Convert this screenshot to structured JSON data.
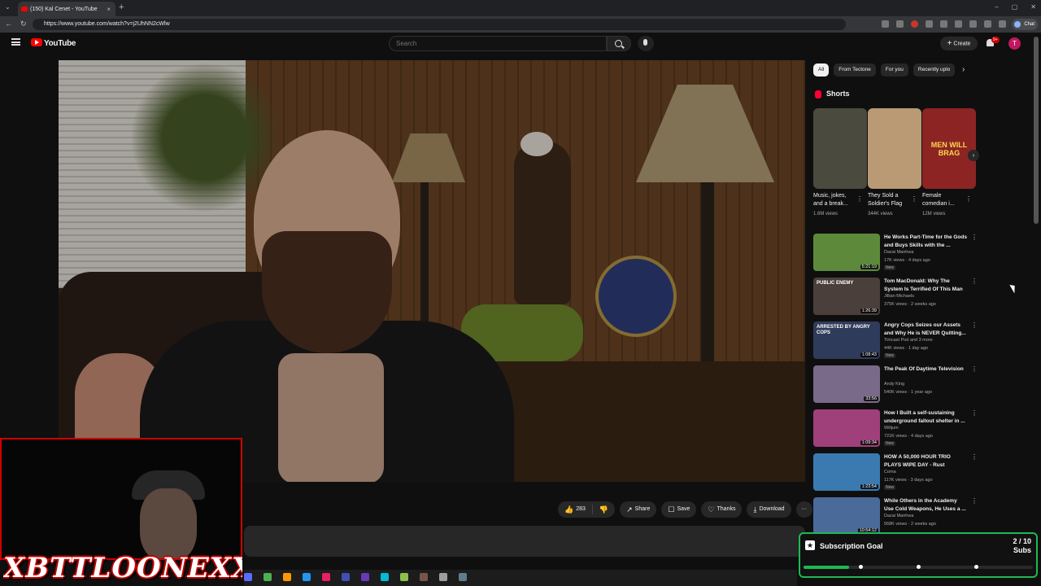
{
  "browser": {
    "tab_title": "(150) Kal Cenet - YouTube",
    "tab_close": "×",
    "new_tab": "+",
    "tabs_menu": "⌄",
    "url": "https://www.youtube.com/watch?v=j2UhNN2cWlw",
    "profile_label": "Chat",
    "back": "←",
    "forward": "→",
    "reload": "↻",
    "win_minimize": "–",
    "win_maximize": "▢",
    "win_close": "✕"
  },
  "header": {
    "logo_text": "YouTube",
    "search_placeholder": "Search",
    "create_label": "Create",
    "create_plus": "+",
    "notif_count": "9+",
    "avatar_letter": "T"
  },
  "actions": {
    "like_count": "283",
    "like_icon": "👍",
    "dislike_icon": "👎",
    "share_label": "Share",
    "share_icon": "↗",
    "save_label": "Save",
    "save_icon": "☐",
    "thanks_label": "Thanks",
    "thanks_icon": "♡",
    "download_label": "Download",
    "download_icon": "⤓",
    "more": "···"
  },
  "overlay": {
    "streamer_name": "XBTTLOONEXX"
  },
  "chips": {
    "items": [
      {
        "label": "All",
        "active": true
      },
      {
        "label": "From Tectone",
        "active": false
      },
      {
        "label": "For you",
        "active": false
      },
      {
        "label": "Recently uplo",
        "active": false
      }
    ],
    "next": "›"
  },
  "shorts": {
    "heading": "Shorts",
    "next": "›",
    "items": [
      {
        "title": "Music, jokes, and a break...",
        "views": "1.6M views",
        "color": "#4b4a3e"
      },
      {
        "title": "They Sold a Soldier's Flag",
        "views": "344K views",
        "color": "#b99a74"
      },
      {
        "title": "Female comedian i...",
        "views": "12M views",
        "color": "#8c2424",
        "overlay_text": "MEN WILL BRAG"
      }
    ],
    "menu": "⋮"
  },
  "recommendations": [
    {
      "title": "He Works Part-Time for the Gods and Buys Skills with the ...",
      "channel": "Dazai Manhwa",
      "meta": "17K views · 4 days ago",
      "badge": "New",
      "duration": "5:21:19",
      "color": "#5c8a3a"
    },
    {
      "title": "Tom MacDonald: Why The System Is Terrified Of This Man",
      "channel": "Jillian Michaels",
      "meta": "375K views · 2 weeks ago",
      "badge": "",
      "duration": "1:26:39",
      "color": "#4a3f3a",
      "overlay_text": "PUBLIC ENEMY"
    },
    {
      "title": "Angry Cops Seizes our Assets and Why He is NEVER Quitting...",
      "channel": "Timcast Pod and 3 more",
      "meta": "44K views · 1 day ago",
      "badge": "New",
      "duration": "1:08:43",
      "color": "#2f3b5a",
      "overlay_text": "ARRESTED BY ANGRY COPS"
    },
    {
      "title": "The Peak Of Daytime Television",
      "channel": "Andy King",
      "meta": "540K views · 1 year ago",
      "badge": "",
      "duration": "33:56",
      "color": "#7a6a8a"
    },
    {
      "title": "How I Built a self-sustaining underground fallout shelter in ...",
      "channel": "Wilijum",
      "meta": "721K views · 4 days ago",
      "badge": "New",
      "duration": "1:09:34",
      "color": "#a0407a"
    },
    {
      "title": "HOW A 50,000 HOUR TRIO PLAYS WIPE DAY - Rust",
      "channel": "Coma",
      "meta": "117K views · 3 days ago",
      "badge": "New",
      "duration": "1:23:54",
      "color": "#3a7ab0"
    },
    {
      "title": "While Others in the Academy Use Cold Weapons, He Uses a ...",
      "channel": "Dazai Manhwa",
      "meta": "568K views · 2 weeks ago",
      "badge": "",
      "duration": "10:54:12",
      "color": "#4a6a9a"
    }
  ],
  "rec_menu": "⋮",
  "sub_goal": {
    "label": "Subscription Goal",
    "current": "2 / 10",
    "unit": "Subs",
    "progress": 0.2,
    "icon": "★"
  },
  "taskbar": {
    "icons": [
      "#5a6cff",
      "#4caf50",
      "#ff9800",
      "#2196f3",
      "#e91e63",
      "#3f51b5",
      "#673ab7",
      "#00bcd4",
      "#8bc34a",
      "#795548",
      "#9e9e9e",
      "#607d8b"
    ]
  }
}
